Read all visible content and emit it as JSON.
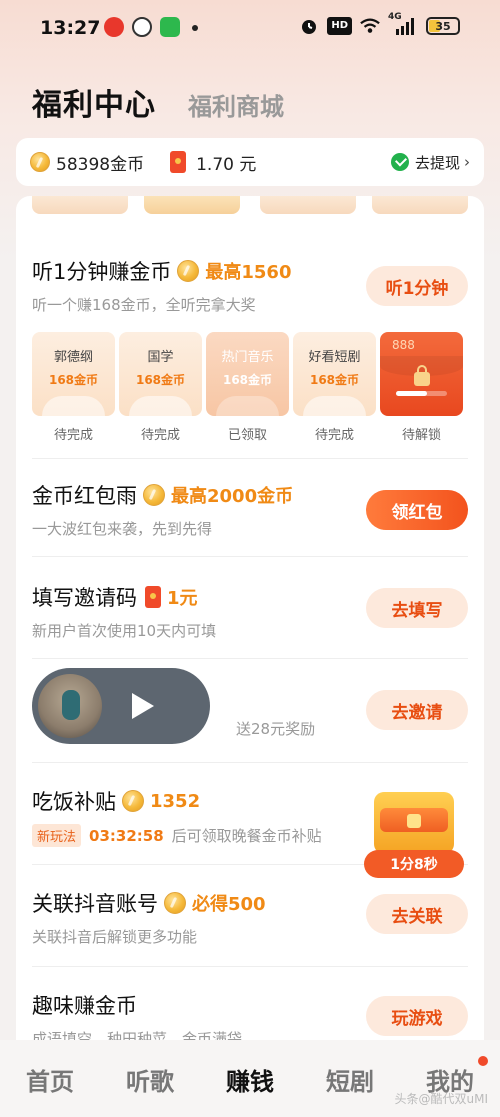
{
  "status_bar": {
    "time": "13:27",
    "hd": "HD",
    "network": "4G",
    "battery": "35"
  },
  "header": {
    "title": "福利中心",
    "tab2": "福利商城"
  },
  "balance": {
    "coins": "58398金币",
    "money": "1.70 元",
    "withdraw": "去提现"
  },
  "tasks": {
    "listen": {
      "title": "听1分钟赚金币",
      "highlight": "最高1560",
      "desc": "听一个赚168金币，全听完拿大奖",
      "button": "听1分钟",
      "chips": [
        {
          "name": "郭德纲",
          "value": "168金币",
          "status": "待完成"
        },
        {
          "name": "国学",
          "value": "168金币",
          "status": "待完成"
        },
        {
          "name": "热门音乐",
          "value": "168金币",
          "status": "已领取"
        },
        {
          "name": "好看短剧",
          "value": "168金币",
          "status": "待完成"
        },
        {
          "name": "888",
          "status": "待解锁",
          "progress": 0.6
        }
      ]
    },
    "rain": {
      "title": "金币红包雨",
      "highlight": "最高2000金币",
      "desc": "一大波红包来袭，先到先得",
      "button": "领红包"
    },
    "invite_code": {
      "title": "填写邀请码",
      "highlight": "1元",
      "desc": "新用户首次使用10天内可填",
      "button": "去填写"
    },
    "invite": {
      "desc_partial": "送28元奖励",
      "button": "去邀请"
    },
    "meal": {
      "title": "吃饭补贴",
      "highlight": "1352",
      "badge": "新玩法",
      "countdown": "03:32:58",
      "desc": "后可领取晚餐金币补贴"
    },
    "douyin": {
      "title": "关联抖音账号",
      "highlight": "必得500",
      "desc": "关联抖音后解锁更多功能",
      "button": "去关联"
    },
    "fun": {
      "title": "趣味赚金币",
      "desc": "成语填空、种田种菜、金币满袋",
      "button": "玩游戏"
    }
  },
  "chest": {
    "timer": "1分8秒"
  },
  "bottom_nav": [
    {
      "label": "首页"
    },
    {
      "label": "听歌"
    },
    {
      "label": "赚钱"
    },
    {
      "label": "短剧"
    },
    {
      "label": "我的"
    }
  ],
  "watermark": "头条@酷代双uMI",
  "colors": {
    "accent": "#f3531d",
    "highlight": "#f08a15",
    "wechat": "#22b14c"
  }
}
